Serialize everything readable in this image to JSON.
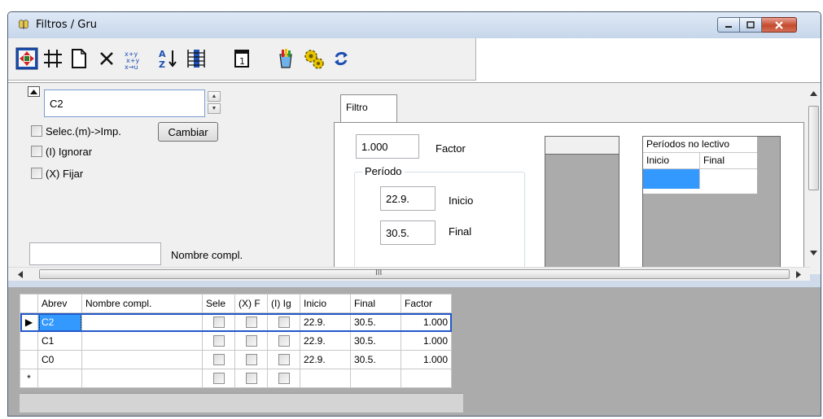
{
  "window": {
    "title": "Filtros / Gru"
  },
  "toolbar": {
    "tools": [
      "move-arrows-icon",
      "grid-icon",
      "new-document-icon",
      "delete-icon",
      "swap-fields-icon",
      "sort-az-icon",
      "column-select-icon",
      "calendar-day-icon",
      "paint-bucket-icon",
      "gears-icon",
      "refresh-icon"
    ],
    "calendar_day_number": "1"
  },
  "filter_panel": {
    "code_value": "C2",
    "checkboxes": [
      {
        "label": "Selec.(m)->Imp."
      },
      {
        "label": "(I) Ignorar"
      },
      {
        "label": "(X) Fijar"
      }
    ],
    "cambiar_label": "Cambiar",
    "nombre_value": "",
    "nombre_label": "Nombre compl."
  },
  "tab": {
    "label": "Filtro",
    "factor_value": "1.000",
    "factor_label": "Factor",
    "periodo_legend": "Período",
    "inicio_value": "22.9.",
    "inicio_label": "Inicio",
    "final_value": "30.5.",
    "final_label": "Final",
    "periodos_table": {
      "title": "Períodos no lectivo",
      "columns": [
        "Inicio",
        "Final"
      ]
    }
  },
  "hscroll_label": "III",
  "grid": {
    "columns": [
      "Abrev",
      "Nombre compl.",
      "Sele",
      "(X) F",
      "(I) Ig",
      "Inicio",
      "Final",
      "Factor"
    ],
    "rows": [
      {
        "abrev": "C2",
        "nombre": "",
        "inicio": "22.9.",
        "final": "30.5.",
        "factor": "1.000"
      },
      {
        "abrev": "C1",
        "nombre": "",
        "inicio": "22.9.",
        "final": "30.5.",
        "factor": "1.000"
      },
      {
        "abrev": "C0",
        "nombre": "",
        "inicio": "22.9.",
        "final": "30.5.",
        "factor": "1.000"
      }
    ],
    "new_row_marker": "*",
    "current_row_marker": "▶"
  },
  "colors": {
    "selection": "#3399ff",
    "window_frame": "#cfdbeb",
    "grid_bg": "#ababab"
  }
}
